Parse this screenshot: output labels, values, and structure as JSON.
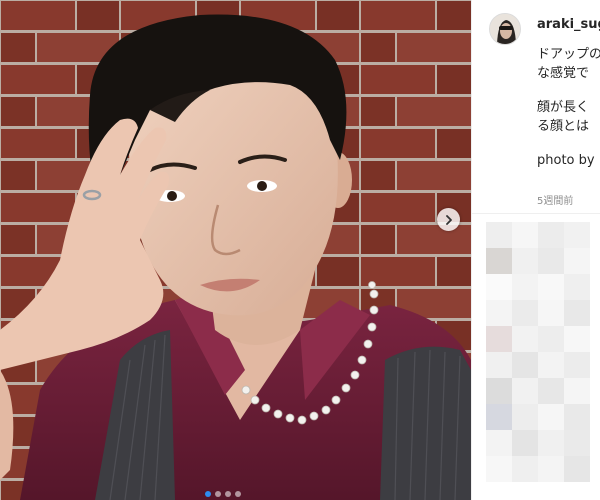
{
  "post": {
    "username": "araki_suge",
    "caption_lines": [
      "ドアップの",
      "な感覚で"
    ],
    "caption_paragraph2": [
      "顔が長く",
      "る顔とは"
    ],
    "photo_credit": "photo by",
    "timestamp": "5週間前"
  },
  "carousel": {
    "next_icon": "chevron-right-icon",
    "slide_count": 4,
    "active_slide": 1
  },
  "comments": {
    "visibility": "pixelated"
  },
  "colors": {
    "brick": "#8a3c30",
    "shirt": "#6b1f35",
    "link": "#2d8cf0"
  }
}
